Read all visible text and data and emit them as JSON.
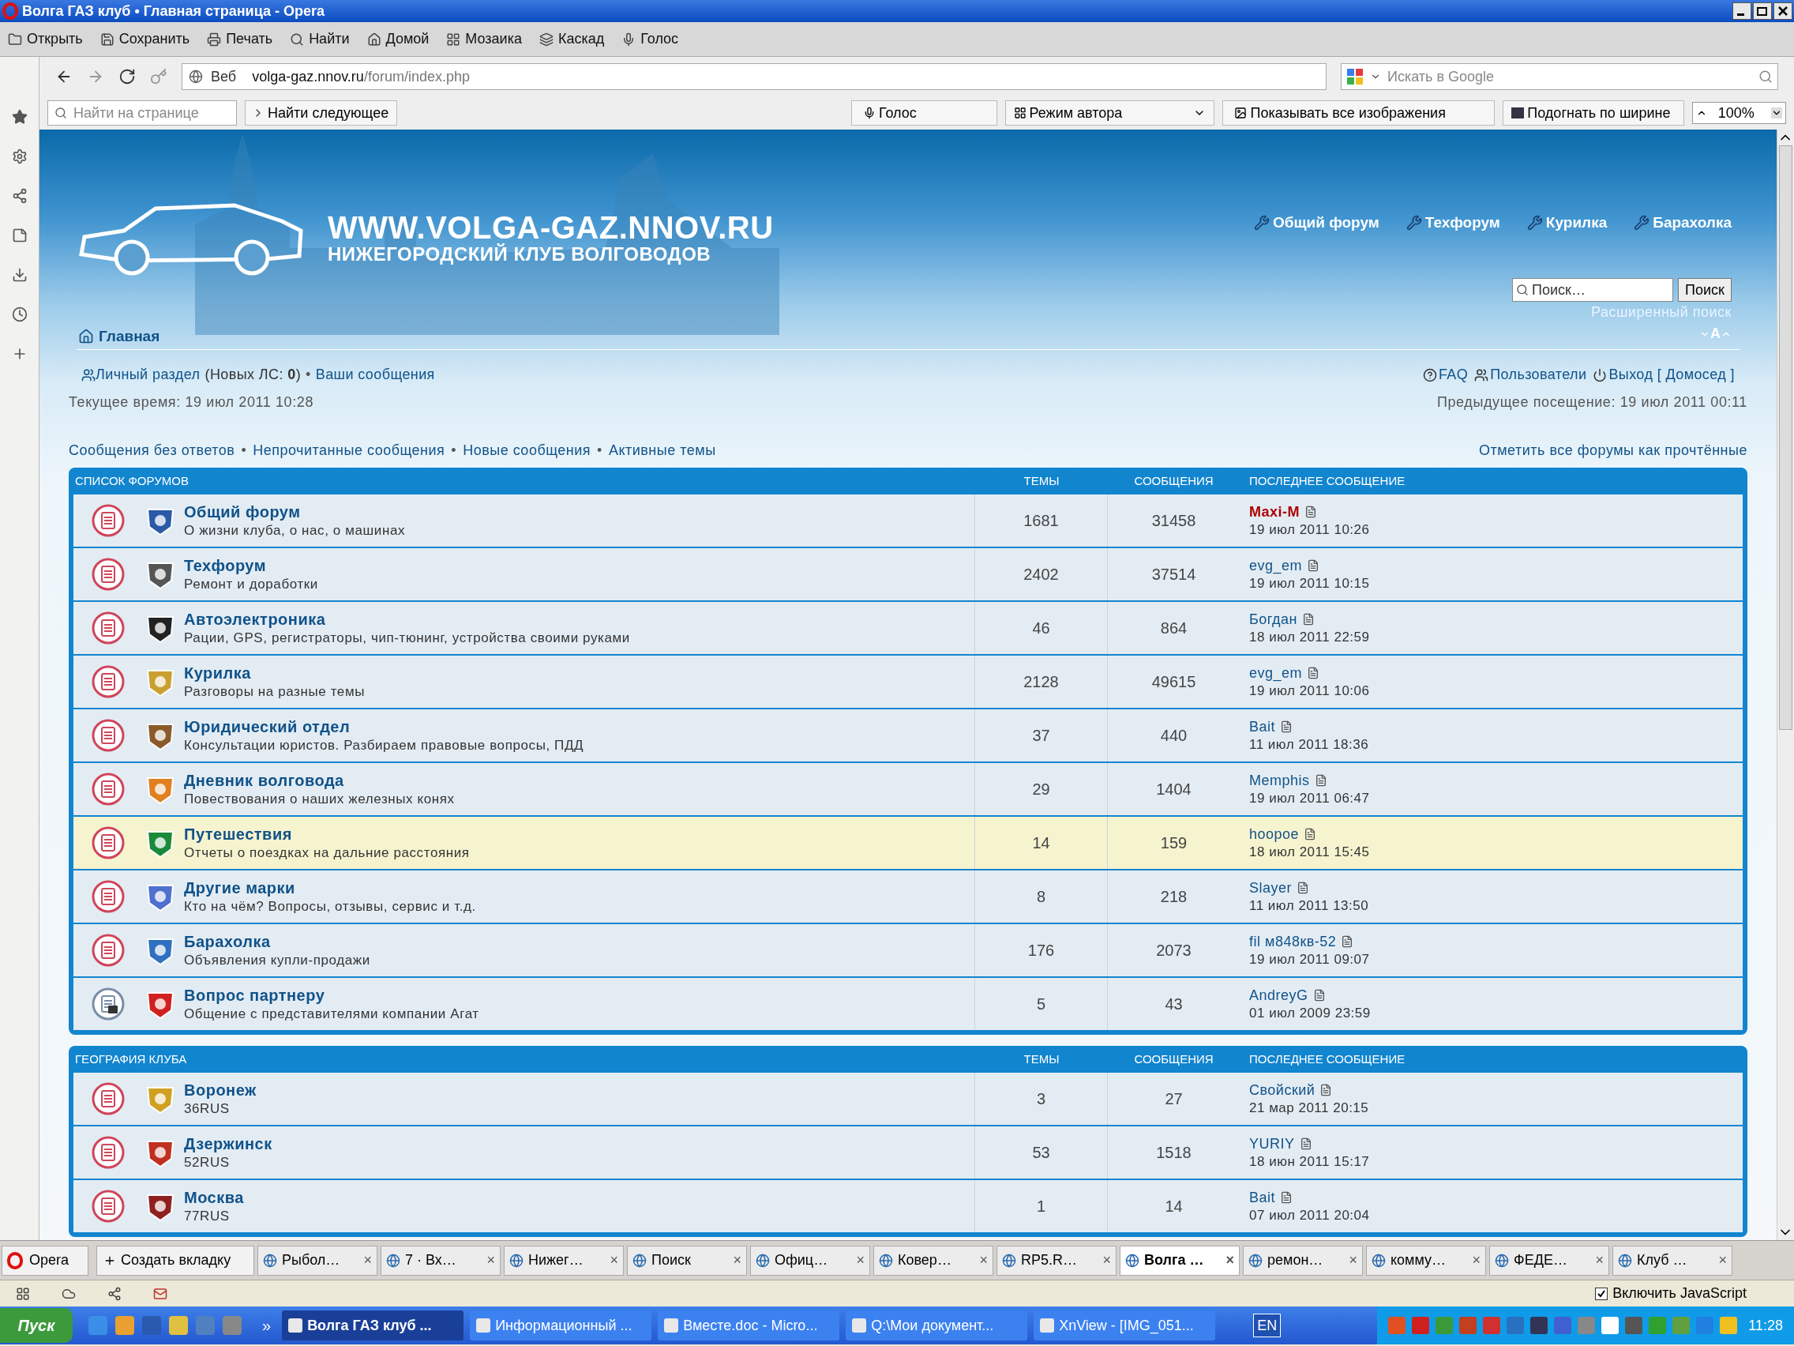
{
  "window": {
    "title": "Волга ГАЗ клуб • Главная страница - Opera"
  },
  "menu": [
    "Открыть",
    "Сохранить",
    "Печать",
    "Найти",
    "Домой",
    "Мозаика",
    "Каскад",
    "Голос"
  ],
  "address": {
    "scope": "Веб",
    "url_host": "volga-gaz.nnov.ru",
    "url_path": "/forum/index.php",
    "search_placeholder": "Искать в Google"
  },
  "find_bar": {
    "placeholder": "Найти на странице",
    "find_next": "Найти следующее",
    "voice": "Голос",
    "author_mode": "Режим автора",
    "show_images": "Показывать все изображения",
    "fit_width": "Подогнать по ширине",
    "zoom": "100%"
  },
  "site": {
    "logo_url": "WWW.VOLGA-GAZ.NNOV.RU",
    "logo_subtitle": "НИЖЕГОРОДСКИЙ КЛУБ ВОЛГОВОДОВ",
    "nav": [
      "Общий форум",
      "Техфорум",
      "Курилка",
      "Барахолка"
    ],
    "search_placeholder": "Поиск…",
    "search_button": "Поиск",
    "advanced_search": "Расширенный поиск",
    "font_resize": "A",
    "breadcrumb": "Главная"
  },
  "user_panel": {
    "personal": "Личный раздел",
    "new_pm": "(Новых ЛС: **0**)",
    "separator": "•",
    "my_posts": "Ваши сообщения",
    "right_links": [
      "FAQ",
      "Пользователи",
      "Выход [ Домосед ]"
    ],
    "current_time": "Текущее время: 19 июл 2011 10:28",
    "last_visit": "Предыдущее посещение: 19 июл 2011 00:11"
  },
  "quick_links": [
    "Сообщения без ответов",
    "Непрочитанные сообщения",
    "Новые сообщения",
    "Активные темы"
  ],
  "mark_read": "Отметить все форумы как прочтённые",
  "categories": [
    {
      "title": "СПИСОК ФОРУМОВ",
      "columns": [
        "ТЕМЫ",
        "СООБЩЕНИЯ",
        "ПОСЛЕДНЕЕ СООБЩЕНИЕ"
      ],
      "forums": [
        {
          "name": "Общий форум",
          "desc": "О жизни клуба, о нас, о машинах",
          "topics": "1681",
          "posts": "31458",
          "author": "Maxi-M",
          "color": "#aa0000",
          "time": "19 июл 2011 10:26",
          "highlighted": false,
          "locked": false
        },
        {
          "name": "Техфорум",
          "desc": "Ремонт и доработки",
          "topics": "2402",
          "posts": "37514",
          "author": "evg_em",
          "color": "#105289",
          "time": "19 июл 2011 10:15",
          "highlighted": false,
          "locked": false
        },
        {
          "name": "Автоэлектроника",
          "desc": "Рации, GPS, регистраторы, чип-тюнинг, устройства своими руками",
          "topics": "46",
          "posts": "864",
          "author": "Богдан",
          "color": "#105289",
          "time": "18 июл 2011 22:59",
          "highlighted": false,
          "locked": false
        },
        {
          "name": "Курилка",
          "desc": "Разговоры на разные темы",
          "topics": "2128",
          "posts": "49615",
          "author": "evg_em",
          "color": "#105289",
          "time": "19 июл 2011 10:06",
          "highlighted": false,
          "locked": false
        },
        {
          "name": "Юридический отдел",
          "desc": "Консультации юристов. Разбираем правовые вопросы, ПДД",
          "topics": "37",
          "posts": "440",
          "author": "Bait",
          "color": "#105289",
          "time": "11 июл 2011 18:36",
          "highlighted": false,
          "locked": false
        },
        {
          "name": "Дневник волговода",
          "desc": "Повествования о наших железных конях",
          "topics": "29",
          "posts": "1404",
          "author": "Memphis",
          "color": "#105289",
          "time": "19 июл 2011 06:47",
          "highlighted": false,
          "locked": false
        },
        {
          "name": "Путешествия",
          "desc": "Отчеты о поездках на дальние расстояния",
          "topics": "14",
          "posts": "159",
          "author": "hoopoe",
          "color": "#105289",
          "time": "18 июл 2011 15:45",
          "highlighted": true,
          "locked": false
        },
        {
          "name": "Другие марки",
          "desc": "Кто на чём? Вопросы, отзывы, сервис и т.д.",
          "topics": "8",
          "posts": "218",
          "author": "Slayer",
          "color": "#105289",
          "time": "11 июл 2011 13:50",
          "highlighted": false,
          "locked": false
        },
        {
          "name": "Барахолка",
          "desc": "Объявления купли-продажи",
          "topics": "176",
          "posts": "2073",
          "author": "fil м848кв-52",
          "color": "#105289",
          "time": "19 июл 2011 09:07",
          "highlighted": false,
          "locked": false
        },
        {
          "name": "Вопрос партнеру",
          "desc": "Общение с представителями компании Агат",
          "topics": "5",
          "posts": "43",
          "author": "AndreyG",
          "color": "#105289",
          "time": "01 июл 2009 23:59",
          "highlighted": false,
          "locked": true
        }
      ]
    },
    {
      "title": "ГЕОГРАФИЯ КЛУБА",
      "columns": [
        "ТЕМЫ",
        "СООБЩЕНИЯ",
        "ПОСЛЕДНЕЕ СООБЩЕНИЕ"
      ],
      "forums": [
        {
          "name": "Воронеж",
          "desc": "36RUS",
          "topics": "3",
          "posts": "27",
          "author": "Свойский",
          "color": "#105289",
          "time": "21 мар 2011 20:15",
          "highlighted": false,
          "locked": false
        },
        {
          "name": "Дзержинск",
          "desc": "52RUS",
          "topics": "53",
          "posts": "1518",
          "author": "YURIY",
          "color": "#105289",
          "time": "18 июн 2011 15:17",
          "highlighted": false,
          "locked": false
        },
        {
          "name": "Москва",
          "desc": "77RUS",
          "topics": "1",
          "posts": "14",
          "author": "Bait",
          "color": "#105289",
          "time": "07 июл 2011 20:04",
          "highlighted": false,
          "locked": false
        }
      ]
    }
  ],
  "tab_bar": {
    "menu": "Opera",
    "new_tab": "Создать вкладку",
    "close_glyph": "×",
    "tabs": [
      {
        "label": "Рыбол…",
        "selected": false
      },
      {
        "label": "7 · Вх…",
        "selected": false
      },
      {
        "label": "Нижег…",
        "selected": false
      },
      {
        "label": "Поиск",
        "selected": false
      },
      {
        "label": "Офиц…",
        "selected": false
      },
      {
        "label": "Ковер…",
        "selected": false
      },
      {
        "label": "RP5.R…",
        "selected": false
      },
      {
        "label": "Волга …",
        "selected": true
      },
      {
        "label": "ремон…",
        "selected": false
      },
      {
        "label": "комму…",
        "selected": false
      },
      {
        "label": "ФЕДЕ…",
        "selected": false
      },
      {
        "label": "Клуб …",
        "selected": false
      }
    ]
  },
  "status_bar": {
    "javascript": {
      "label": "Включить JavaScript",
      "checked": true
    }
  },
  "taskbar": {
    "start": "Пуск",
    "more": "»",
    "windows": [
      {
        "label": "Волга ГАЗ клуб ...",
        "selected": true
      },
      {
        "label": "Информационный ...",
        "selected": false
      },
      {
        "label": "Вместе.doc - Micro...",
        "selected": false
      },
      {
        "label": "Q:\\Мои документ...",
        "selected": false
      },
      {
        "label": "XnView - [IMG_051...",
        "selected": false
      }
    ],
    "language": "EN",
    "clock": "11:28"
  }
}
